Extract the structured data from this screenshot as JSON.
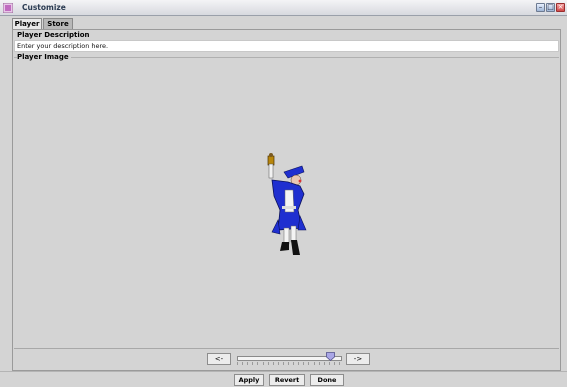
{
  "window": {
    "title": "Customize"
  },
  "tabs": [
    {
      "label": "Player",
      "active": true
    },
    {
      "label": "Store",
      "active": false
    }
  ],
  "description": {
    "label": "Player Description",
    "value": "Enter your description here."
  },
  "image_section": {
    "label": "Player Image"
  },
  "navigation": {
    "prev_label": "<-",
    "next_label": "->",
    "slider_value": 0.95
  },
  "footer": {
    "apply_label": "Apply",
    "revert_label": "Revert",
    "done_label": "Done"
  },
  "colors": {
    "character_blue": "#1f2fd0",
    "slider_thumb": "#a9a6e6"
  }
}
